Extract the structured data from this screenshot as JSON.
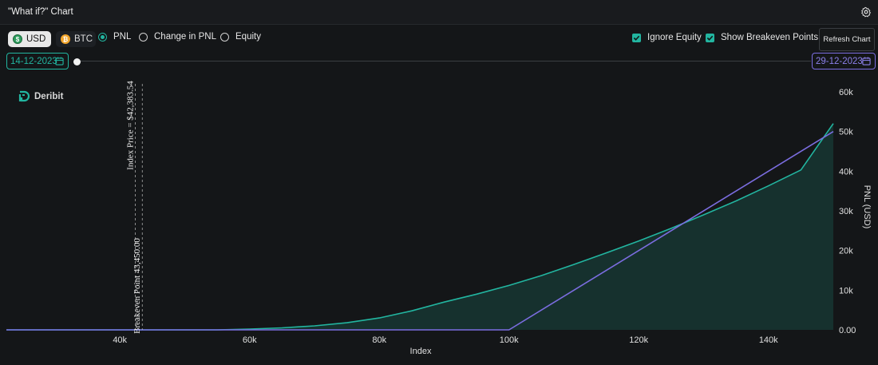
{
  "header": {
    "title": "\"What if?\" Chart",
    "settings_icon": "gear-icon"
  },
  "currency": {
    "usd_label": "USD",
    "btc_label": "BTC",
    "usd_icon": "$",
    "btc_icon": "₿"
  },
  "mode": {
    "options": [
      "PNL",
      "Change in PNL",
      "Equity"
    ],
    "selected": "PNL"
  },
  "toggles": {
    "ignore_equity": "Ignore Equity",
    "show_breakeven": "Show Breakeven Points"
  },
  "refresh_label": "Refresh Chart",
  "dates": {
    "start": "14-12-2023",
    "end": "29-12-2023"
  },
  "logo_text": "Deribit",
  "colors": {
    "accent": "#22b5a0",
    "purple": "#7b6de0",
    "background": "#141618"
  },
  "chart_data": {
    "type": "line",
    "xlabel": "Index",
    "ylabel": "PNL (USD)",
    "xlim": [
      22500,
      150000
    ],
    "ylim": [
      0,
      60000
    ],
    "x_ticks": [
      40000,
      60000,
      80000,
      100000,
      120000,
      140000
    ],
    "x_tick_labels": [
      "40k",
      "60k",
      "80k",
      "100k",
      "120k",
      "140k"
    ],
    "y_ticks": [
      0,
      10000,
      20000,
      30000,
      40000,
      50000,
      60000
    ],
    "y_tick_labels": [
      "0.00",
      "10k",
      "20k",
      "30k",
      "40k",
      "50k",
      "60k"
    ],
    "annotations": [
      {
        "label": "Index Price = $42,383.54",
        "x": 42383.54
      },
      {
        "label": "Breakeven Point 43,450.00",
        "x": 43450
      }
    ],
    "series": [
      {
        "color": "#22b5a0",
        "filled": true,
        "x": [
          22500,
          55000,
          60000,
          65000,
          70000,
          75000,
          80000,
          85000,
          90000,
          95000,
          100000,
          105000,
          110000,
          115000,
          120000,
          125000,
          130000,
          135000,
          140000,
          145000,
          150000
        ],
        "y": [
          0,
          0,
          200,
          500,
          1000,
          1800,
          3000,
          4800,
          7000,
          9000,
          11200,
          13700,
          16500,
          19400,
          22400,
          25600,
          29000,
          32500,
          36300,
          40300,
          52000
        ]
      },
      {
        "color": "#7b6de0",
        "filled": false,
        "x": [
          22500,
          100000,
          150000
        ],
        "y": [
          0,
          0,
          50000
        ]
      }
    ]
  }
}
